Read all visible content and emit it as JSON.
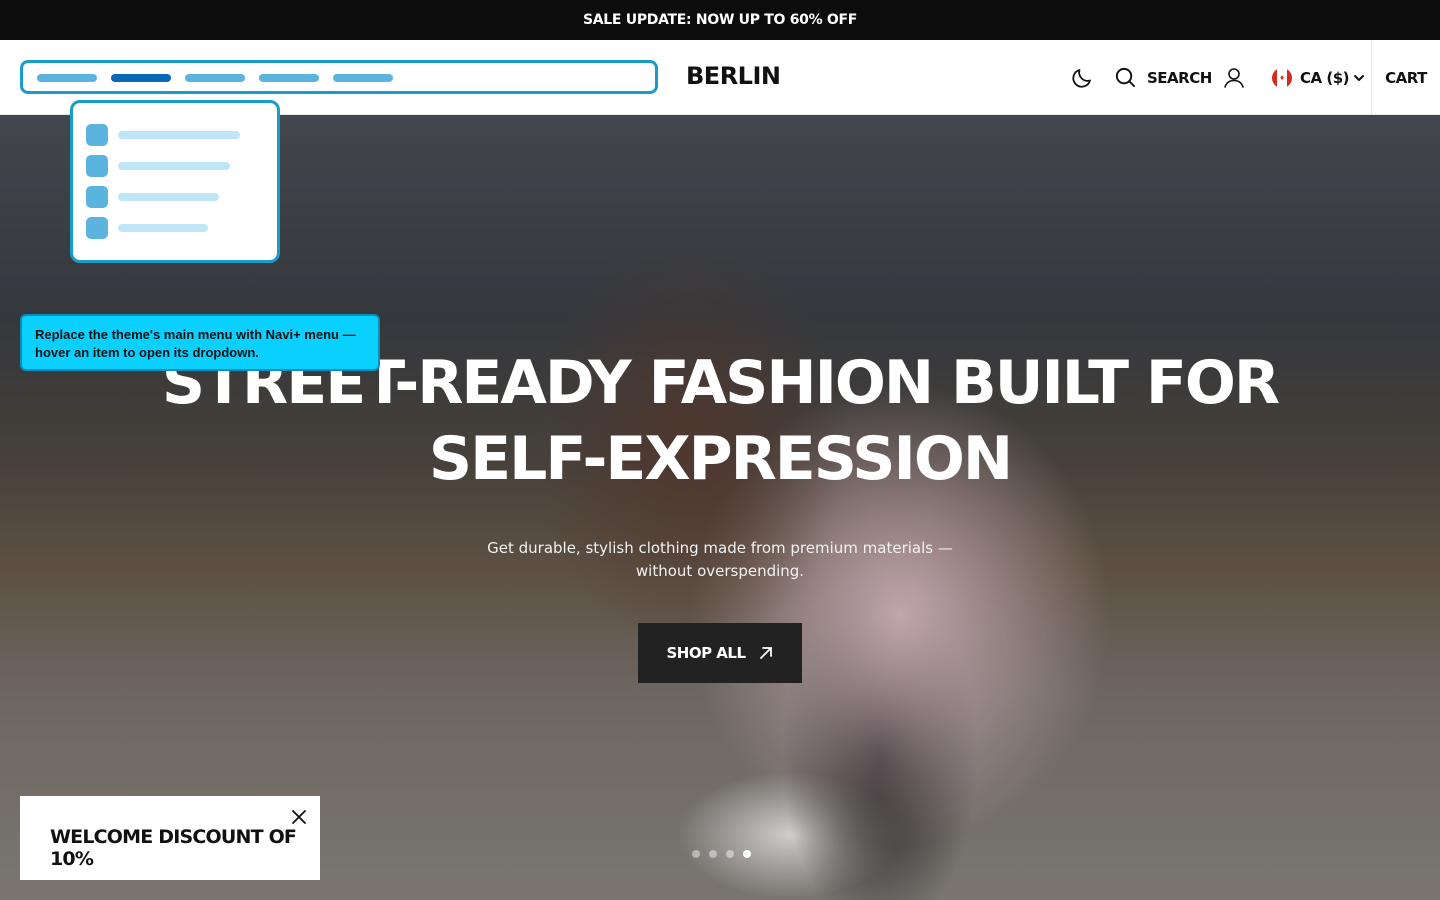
{
  "announcement": {
    "text": "SALE UPDATE: NOW UP TO 60% OFF"
  },
  "header": {
    "logo": "BERLIN",
    "search_label": "SEARCH",
    "currency_label": "CA ($)",
    "cart_label": "CART",
    "theme_toggle_icon": "moon-icon",
    "search_icon": "search-icon",
    "account_icon": "user-icon",
    "chevron_icon": "chevron-down-icon",
    "flag_icon": "canada-flag-icon"
  },
  "menu_preview": {
    "items": 5,
    "active_index": 1,
    "accent": "#1a9cc9"
  },
  "dropdown_preview": {
    "items": 4
  },
  "tooltip": {
    "text": "Replace the theme's main menu with Navi+ menu — hover an item to open its dropdown."
  },
  "hero": {
    "headline_line1": "STREET-READY FASHION BUILT FOR",
    "headline_line2": "SELF-EXPRESSION",
    "subtext": "Get durable, stylish clothing made from premium materials —without overspending.",
    "cta_label": "SHOP ALL",
    "cta_icon": "arrow-up-right-icon",
    "slides": 4,
    "active_slide": 4
  },
  "discount_popup": {
    "text": "WELCOME DISCOUNT OF 10%",
    "close_icon": "close-icon"
  },
  "colors": {
    "accent": "#1a9cc9",
    "tooltip_bg": "#0ad0ff",
    "announcement_bg": "#0c0c0c"
  }
}
